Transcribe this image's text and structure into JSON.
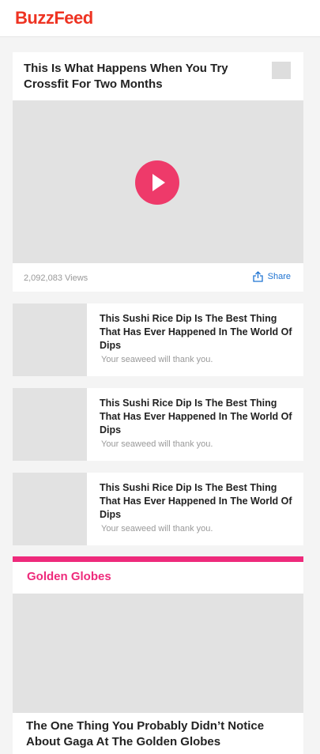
{
  "header": {
    "logo": "BuzzFeed",
    "logo_color": "#ee3322"
  },
  "video": {
    "title": "This Is What Happens When You Try Crossfit For Two Months",
    "views": "2,092,083 Views",
    "share_label": "Share",
    "play_color": "#ee3a6a"
  },
  "list_items": [
    {
      "title": "This Sushi Rice Dip Is The Best Thing That Has Ever Happened In The World Of Dips",
      "subtitle": "Your seaweed will thank you."
    },
    {
      "title": "This Sushi Rice Dip Is The Best Thing That Has Ever Happened In The World Of Dips",
      "subtitle": "Your seaweed will thank you."
    },
    {
      "title": "This Sushi Rice Dip Is The Best Thing That Has Ever Happened In The World Of Dips",
      "subtitle": "Your seaweed will thank you."
    }
  ],
  "section": {
    "title": "Golden Globes",
    "accent_color": "#ee2a7b",
    "feature_title": "The One Thing You Probably Didn’t Notice About Gaga At The Golden Globes"
  }
}
